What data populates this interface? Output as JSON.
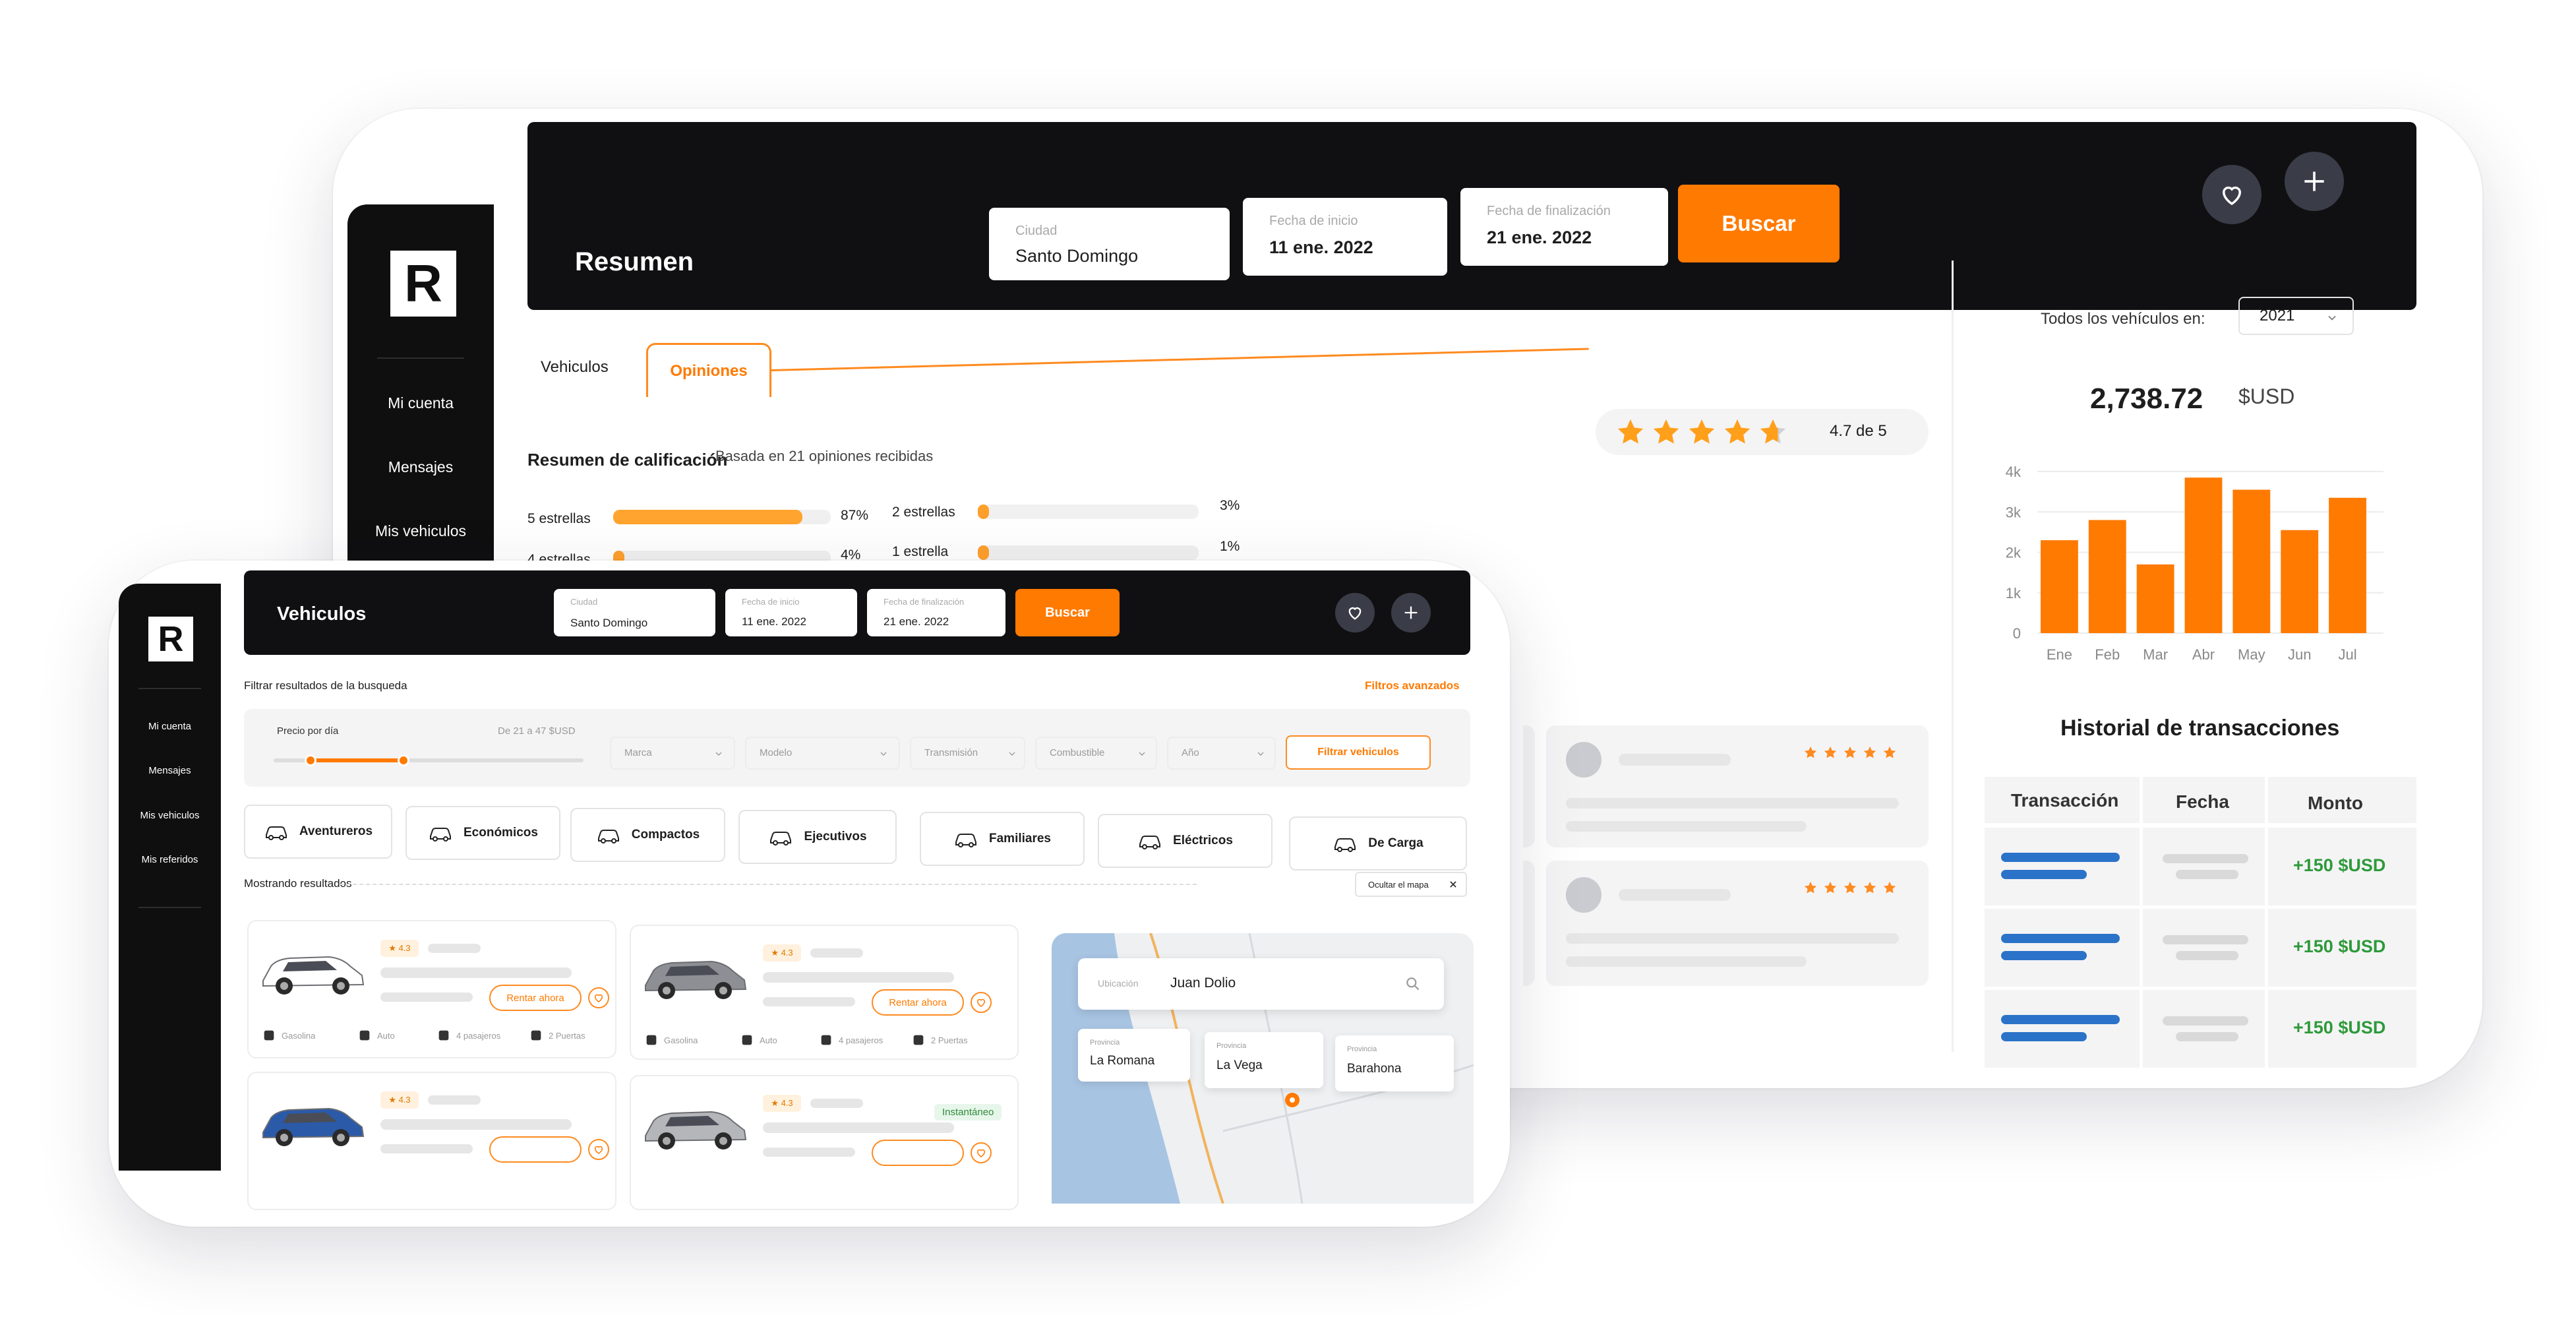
{
  "brand": {
    "logo_letter": "R",
    "accent": "#ff7a00"
  },
  "nav": {
    "items": [
      "Mi cuenta",
      "Mensajes",
      "Mis vehiculos",
      "Mis referidos"
    ]
  },
  "back": {
    "header": {
      "title": "Resumen",
      "city_label": "Ciudad",
      "city_value": "Santo Domingo",
      "start_label": "Fecha de inicio",
      "start_value": "11 ene. 2022",
      "end_label": "Fecha de finalización",
      "end_value": "21 ene. 2022",
      "search_label": "Buscar"
    },
    "tabs": [
      "Vehiculos",
      "Opiniones"
    ],
    "active_tab": "Opiniones",
    "rating": {
      "title": "Resumen de calificación",
      "subtitle": "Basada en 21 opiniones recibidas",
      "score": 4.7,
      "score_text": "4.7 de 5",
      "rows": [
        {
          "label": "5 estrellas",
          "percent": 87,
          "percent_text": "87%"
        },
        {
          "label": "4 estrellas",
          "percent": 4,
          "percent_text": "4%"
        },
        {
          "label": "2 estrellas",
          "percent": 3,
          "percent_text": "3%"
        },
        {
          "label": "1 estrella",
          "percent": 1,
          "percent_text": "1%"
        }
      ]
    },
    "stats": {
      "filter_label": "Todos los vehículos en:",
      "year": "2021",
      "total": "2,738.72",
      "currency": "$USD"
    },
    "transactions": {
      "title": "Historial de transacciones",
      "columns": [
        "Transacción",
        "Fecha",
        "Monto"
      ],
      "amounts": [
        "+150 $USD",
        "+150 $USD",
        "+150 $USD"
      ]
    }
  },
  "chart_data": {
    "type": "bar",
    "categories": [
      "Ene",
      "Feb",
      "Mar",
      "Abr",
      "May",
      "Jun",
      "Jul"
    ],
    "values": [
      2300,
      2800,
      1700,
      3850,
      3550,
      2550,
      3350
    ],
    "y_ticks": [
      "0",
      "1k",
      "2k",
      "3k",
      "4k"
    ],
    "ylim": [
      0,
      4000
    ],
    "color": "#ff7a00",
    "grid": true
  },
  "front": {
    "header": {
      "title": "Vehiculos",
      "city_label": "Ciudad",
      "city_value": "Santo Domingo",
      "start_label": "Fecha de inicio",
      "start_value": "11 ene. 2022",
      "end_label": "Fecha de finalización",
      "end_value": "21 ene. 2022",
      "search_label": "Buscar"
    },
    "filters": {
      "title": "Filtrar resultados de la busqueda",
      "advanced": "Filtros avanzados",
      "price_label": "Precio por día",
      "price_range": "De 21 a 47 $USD",
      "price_low_fraction": 0.12,
      "price_high_fraction": 0.42,
      "selects": [
        "Marca",
        "Modelo",
        "Transmisión",
        "Combustible",
        "Año"
      ],
      "apply": "Filtrar vehiculos"
    },
    "categories": [
      "Aventureros",
      "Económicos",
      "Compactos",
      "Ejecutivos",
      "Familiares",
      "Eléctricos",
      "De Carga"
    ],
    "results_label": "Mostrando resultados",
    "hide_map": "Ocultar el mapa",
    "cars": [
      {
        "rating": "★ 4.3",
        "rent": "Rentar ahora",
        "fuel": "Gasolina",
        "trans": "Auto",
        "seats": "4 pasajeros",
        "doors": "2 Puertas",
        "color": "#ffffff"
      },
      {
        "rating": "★ 4.3",
        "rent": "Rentar ahora",
        "fuel": "Gasolina",
        "trans": "Auto",
        "seats": "4 pasajeros",
        "doors": "2 Puertas",
        "color": "#8d8f94"
      },
      {
        "rating": "★ 4.3",
        "color": "#2b5aa8"
      },
      {
        "rating": "★ 4.3",
        "instant": "Instantáneo",
        "color": "#b5b6ba"
      }
    ],
    "map": {
      "location_label": "Ubicación",
      "location_value": "Juan Dolio",
      "province_label": "Provincia",
      "provinces": [
        "La Romana",
        "La Vega",
        "Barahona"
      ]
    }
  }
}
